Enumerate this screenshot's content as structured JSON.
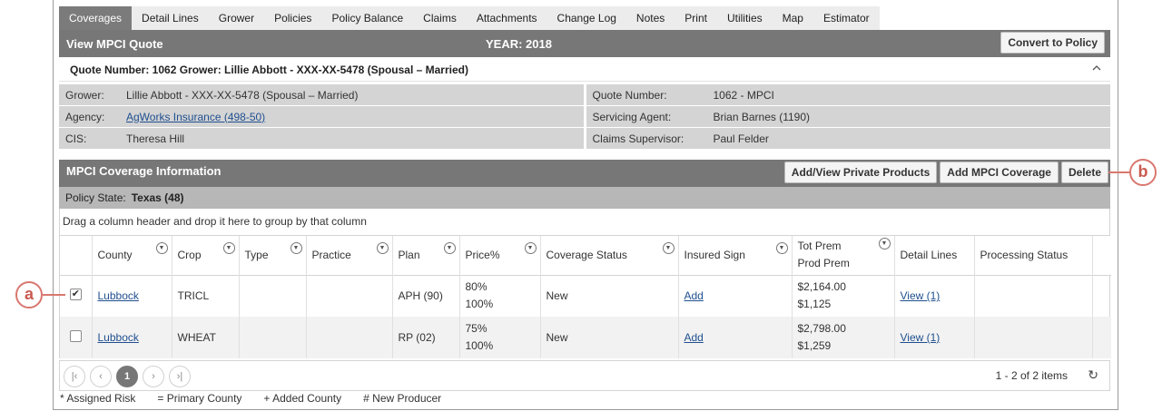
{
  "tabs": [
    "Coverages",
    "Detail Lines",
    "Grower",
    "Policies",
    "Policy Balance",
    "Claims",
    "Attachments",
    "Change Log",
    "Notes",
    "Print",
    "Utilities",
    "Map",
    "Estimator"
  ],
  "header": {
    "title": "View MPCI Quote",
    "year": "YEAR: 2018",
    "convert_label": "Convert to Policy"
  },
  "quote": {
    "summary": "Quote Number: 1062 Grower: Lillie Abbott - XXX-XX-5478 (Spousal – Married)"
  },
  "info": {
    "grower_label": "Grower:",
    "grower_value": "Lillie Abbott - XXX-XX-5478 (Spousal – Married)",
    "agency_label": "Agency:",
    "agency_value": "AgWorks Insurance (498-50)",
    "cis_label": "CIS:",
    "cis_value": "Theresa Hill",
    "quote_number_label": "Quote Number:",
    "quote_number_value": "1062 - MPCI",
    "servicing_agent_label": "Servicing Agent:",
    "servicing_agent_value": "Brian Barnes (1190)",
    "claims_supervisor_label": "Claims Supervisor:",
    "claims_supervisor_value": "Paul Felder"
  },
  "coverage": {
    "title": "MPCI Coverage Information",
    "buttons": {
      "private_products": "Add/View Private Products",
      "add_mpci": "Add MPCI Coverage",
      "delete": "Delete"
    },
    "policy_state_label": "Policy State:",
    "policy_state_value": "Texas (48)",
    "group_hint": "Drag a column header and drop it here to group by that column"
  },
  "grid": {
    "columns": {
      "county": "County",
      "crop": "Crop",
      "type": "Type",
      "practice": "Practice",
      "plan": "Plan",
      "price": "Price%",
      "coverage_status": "Coverage Status",
      "insured_sign": "Insured Sign",
      "tot_prem": "Tot Prem",
      "prod_prem": "Prod Prem",
      "detail_lines": "Detail Lines",
      "processing_status": "Processing Status"
    },
    "rows": [
      {
        "checked": true,
        "county": "Lubbock",
        "crop": "TRICL",
        "type": "",
        "practice": "",
        "plan": "APH (90)",
        "price_1": "80%",
        "price_2": "100%",
        "coverage_status": "New",
        "insured_sign": "Add",
        "tot_prem": "$2,164.00",
        "prod_prem": "$1,125",
        "detail_lines": "View (1)",
        "processing_status": ""
      },
      {
        "checked": false,
        "county": "Lubbock",
        "crop": "WHEAT",
        "type": "",
        "practice": "",
        "plan": "RP (02)",
        "price_1": "75%",
        "price_2": "100%",
        "coverage_status": "New",
        "insured_sign": "Add",
        "tot_prem": "$2,798.00",
        "prod_prem": "$1,259",
        "detail_lines": "View (1)",
        "processing_status": ""
      }
    ]
  },
  "pager": {
    "current_page": "1",
    "items_text": "1 - 2 of 2 items"
  },
  "legend": [
    "* Assigned Risk",
    "= Primary County",
    "+ Added County",
    "# New Producer"
  ],
  "callouts": {
    "a": "a",
    "b": "b"
  },
  "colors": {
    "header_bg": "#777777",
    "info_bg": "#d4d4d4",
    "callout": "#d9776f",
    "link": "#1f4f8f"
  }
}
